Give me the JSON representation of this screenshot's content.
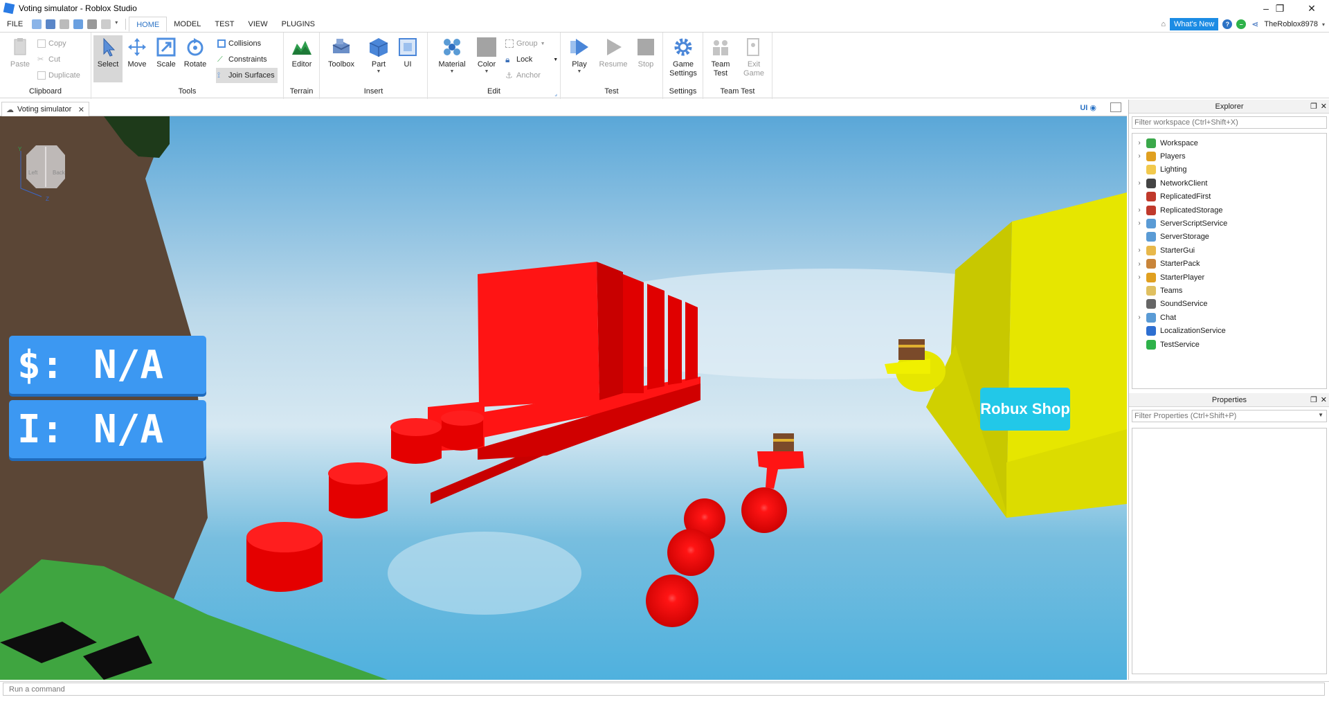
{
  "window": {
    "title": "Voting simulator - Roblox Studio",
    "controls": [
      "–",
      "❐",
      "✕"
    ]
  },
  "menu": {
    "file": "FILE",
    "tabs": [
      "HOME",
      "MODEL",
      "TEST",
      "VIEW",
      "PLUGINS"
    ],
    "active_tab": "HOME",
    "whats_new": "What's New",
    "username": "TheRoblox8978"
  },
  "ribbon": {
    "clipboard": {
      "paste": "Paste",
      "copy": "Copy",
      "cut": "Cut",
      "duplicate": "Duplicate",
      "group_label": "Clipboard"
    },
    "tools": {
      "select": "Select",
      "move": "Move",
      "scale": "Scale",
      "rotate": "Rotate",
      "collisions": "Collisions",
      "constraints": "Constraints",
      "join_surfaces": "Join Surfaces",
      "group_label": "Tools"
    },
    "terrain": {
      "editor": "Editor",
      "group_label": "Terrain"
    },
    "insert": {
      "toolbox": "Toolbox",
      "part": "Part",
      "ui": "UI",
      "group_label": "Insert"
    },
    "edit": {
      "material": "Material",
      "color": "Color",
      "group": "Group",
      "lock": "Lock",
      "anchor": "Anchor",
      "group_label": "Edit"
    },
    "test": {
      "play": "Play",
      "resume": "Resume",
      "stop": "Stop",
      "group_label": "Test"
    },
    "settings": {
      "game_settings_1": "Game",
      "game_settings_2": "Settings",
      "group_label": "Settings"
    },
    "team_test": {
      "team_test_1": "Team",
      "team_test_2": "Test",
      "exit_game_1": "Exit",
      "exit_game_2": "Game",
      "group_label": "Team Test"
    }
  },
  "document_tab": {
    "label": "Voting simulator",
    "close": "✕"
  },
  "viewport": {
    "ui_toggle": "UI",
    "hud": {
      "money_label": "$:",
      "money_value": "N/A",
      "influence_label": "I:",
      "influence_value": "N/A",
      "robux_shop": "Robux Shop"
    }
  },
  "explorer": {
    "title": "Explorer",
    "filter_placeholder": "Filter workspace (Ctrl+Shift+X)",
    "items": [
      {
        "label": "Workspace",
        "expandable": true,
        "icon_color": "#3aa84a"
      },
      {
        "label": "Players",
        "expandable": true,
        "icon_color": "#e0a020"
      },
      {
        "label": "Lighting",
        "expandable": false,
        "icon_color": "#f2c94c"
      },
      {
        "label": "NetworkClient",
        "expandable": true,
        "icon_color": "#444444"
      },
      {
        "label": "ReplicatedFirst",
        "expandable": false,
        "icon_color": "#c0392b"
      },
      {
        "label": "ReplicatedStorage",
        "expandable": true,
        "icon_color": "#c0392b"
      },
      {
        "label": "ServerScriptService",
        "expandable": true,
        "icon_color": "#5a9bd5"
      },
      {
        "label": "ServerStorage",
        "expandable": false,
        "icon_color": "#5a9bd5"
      },
      {
        "label": "StarterGui",
        "expandable": true,
        "icon_color": "#e8b84a"
      },
      {
        "label": "StarterPack",
        "expandable": true,
        "icon_color": "#c9853a"
      },
      {
        "label": "StarterPlayer",
        "expandable": true,
        "icon_color": "#e0a020"
      },
      {
        "label": "Teams",
        "expandable": false,
        "icon_color": "#e0c060"
      },
      {
        "label": "SoundService",
        "expandable": false,
        "icon_color": "#666666"
      },
      {
        "label": "Chat",
        "expandable": true,
        "icon_color": "#5a9bd5"
      },
      {
        "label": "LocalizationService",
        "expandable": false,
        "icon_color": "#2e6fd1"
      },
      {
        "label": "TestService",
        "expandable": false,
        "icon_color": "#2eb24a"
      }
    ]
  },
  "properties": {
    "title": "Properties",
    "filter_placeholder": "Filter Properties (Ctrl+Shift+P)"
  },
  "command_bar": {
    "placeholder": "Run a command"
  },
  "colors": {
    "accent": "#2c73c5",
    "whats_new_bg": "#1c8ce4",
    "hud_panel": "#3c98f2",
    "robux_shop": "#22c8e8"
  }
}
